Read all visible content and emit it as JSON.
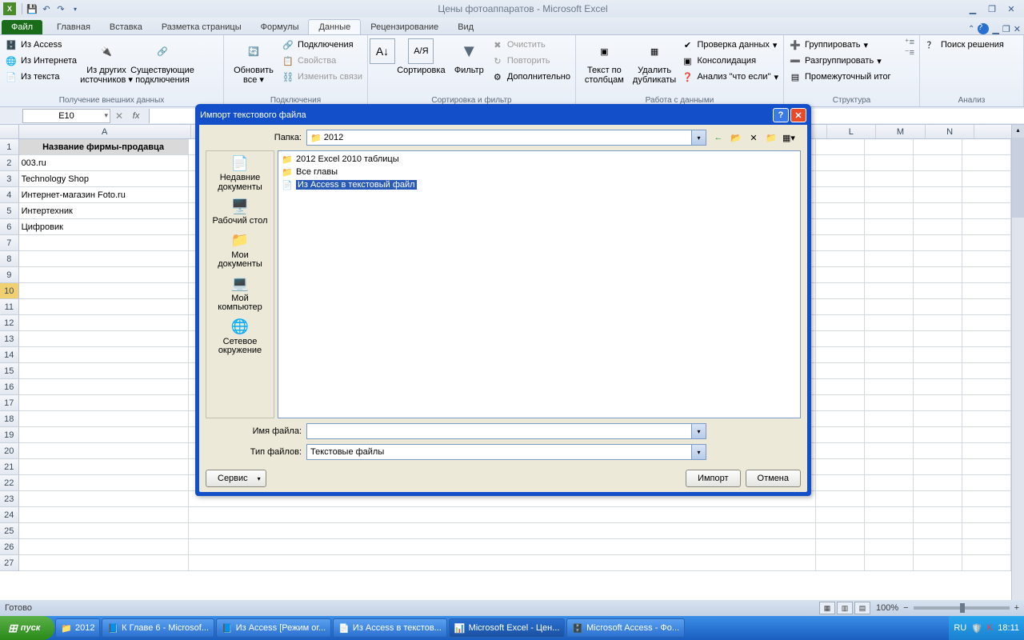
{
  "titlebar": {
    "title": "Цены фотоаппаратов  -  Microsoft Excel"
  },
  "tabs": {
    "file": "Файл",
    "home": "Главная",
    "insert": "Вставка",
    "layout": "Разметка страницы",
    "formulas": "Формулы",
    "data": "Данные",
    "review": "Рецензирование",
    "view": "Вид"
  },
  "ribbon": {
    "g1": {
      "access": "Из Access",
      "web": "Из Интернета",
      "text": "Из текста",
      "other": "Из других источников",
      "exist": "Существующие подключения",
      "lbl": "Получение внешних данных"
    },
    "g2": {
      "refresh": "Обновить все",
      "conn": "Подключения",
      "props": "Свойства",
      "links": "Изменить связи",
      "lbl": "Подключения"
    },
    "g3": {
      "sort": "Сортировка",
      "filter": "Фильтр",
      "clear": "Очистить",
      "reapply": "Повторить",
      "adv": "Дополнительно",
      "lbl": "Сортировка и фильтр"
    },
    "g4": {
      "t2c": "Текст по столбцам",
      "dup": "Удалить дубликаты",
      "val": "Проверка данных",
      "cons": "Консолидация",
      "whatif": "Анализ \"что если\"",
      "lbl": "Работа с данными"
    },
    "g5": {
      "grp": "Группировать",
      "ungrp": "Разгруппировать",
      "sub": "Промежуточный итог",
      "lbl": "Структура"
    },
    "g6": {
      "solver": "Поиск решения",
      "lbl": "Анализ"
    }
  },
  "fbar": {
    "ref": "E10"
  },
  "cols": [
    "A",
    "",
    "",
    "",
    "",
    "",
    "",
    "",
    "",
    "",
    "L",
    "M",
    "N",
    ""
  ],
  "rows": [
    {
      "n": 1,
      "a": "Название фирмы-продавца",
      "hdr": true
    },
    {
      "n": 2,
      "a": "003.ru"
    },
    {
      "n": 3,
      "a": "Technology Shop"
    },
    {
      "n": 4,
      "a": "Интернет-магазин Foto.ru"
    },
    {
      "n": 5,
      "a": "Интертехник"
    },
    {
      "n": 6,
      "a": "Цифровик"
    },
    {
      "n": 7,
      "a": ""
    },
    {
      "n": 8,
      "a": ""
    },
    {
      "n": 9,
      "a": ""
    },
    {
      "n": 10,
      "a": "",
      "sel": true
    },
    {
      "n": 11,
      "a": ""
    },
    {
      "n": 12,
      "a": ""
    },
    {
      "n": 13,
      "a": ""
    },
    {
      "n": 14,
      "a": ""
    },
    {
      "n": 15,
      "a": ""
    },
    {
      "n": 16,
      "a": ""
    },
    {
      "n": 17,
      "a": ""
    },
    {
      "n": 18,
      "a": ""
    },
    {
      "n": 19,
      "a": ""
    },
    {
      "n": 20,
      "a": ""
    },
    {
      "n": 21,
      "a": ""
    },
    {
      "n": 22,
      "a": ""
    },
    {
      "n": 23,
      "a": ""
    },
    {
      "n": 24,
      "a": ""
    },
    {
      "n": 25,
      "a": ""
    },
    {
      "n": 26,
      "a": ""
    },
    {
      "n": 27,
      "a": ""
    }
  ],
  "sheet": {
    "name": "Цены фотоаппаратов"
  },
  "status": {
    "ready": "Готово",
    "zoom": "100%"
  },
  "dialog": {
    "title": "Импорт текстового файла",
    "folder_lbl": "Папка:",
    "folder_val": "2012",
    "side": [
      "Недавние документы",
      "Рабочий стол",
      "Мои документы",
      "Мой компьютер",
      "Сетевое окружение"
    ],
    "files": [
      {
        "t": "folder",
        "n": "2012 Excel 2010 таблицы"
      },
      {
        "t": "folder",
        "n": "Все главы"
      },
      {
        "t": "file",
        "n": "Из Access в текстовый файл",
        "sel": true
      }
    ],
    "name_lbl": "Имя файла:",
    "type_lbl": "Тип файлов:",
    "type_val": "Текстовые файлы",
    "service": "Сервис",
    "import": "Импорт",
    "cancel": "Отмена"
  },
  "taskbar": {
    "start": "пуск",
    "items": [
      "2012",
      "К Главе 6 - Microsof...",
      "Из Access [Режим ог...",
      "Из Access в текстов...",
      "Microsoft Excel - Цен...",
      "Microsoft Access - Фо..."
    ],
    "lang": "RU",
    "time": "18:11"
  }
}
